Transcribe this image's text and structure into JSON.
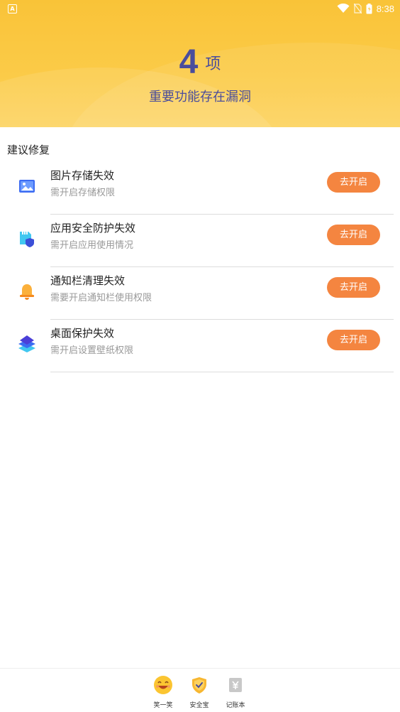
{
  "status_bar": {
    "left_icon": "A",
    "time": "8:38"
  },
  "header": {
    "count": "4",
    "count_unit": "项",
    "subtitle": "重要功能存在漏洞"
  },
  "section": {
    "title": "建议修复"
  },
  "items": [
    {
      "title": "图片存储失效",
      "desc": "需开启存储权限",
      "button": "去开启",
      "icon": "image-icon"
    },
    {
      "title": "应用安全防护失效",
      "desc": "需开启应用使用情况",
      "button": "去开启",
      "icon": "app-shield-icon"
    },
    {
      "title": "通知栏清理失效",
      "desc": "需要开启通知栏使用权限",
      "button": "去开启",
      "icon": "bell-icon"
    },
    {
      "title": "桌面保护失效",
      "desc": "需开启设置壁纸权限",
      "button": "去开启",
      "icon": "layers-icon"
    }
  ],
  "bottom_nav": [
    {
      "label": "笑一笑",
      "icon": "smile-icon"
    },
    {
      "label": "安全宝",
      "icon": "shield-check-icon"
    },
    {
      "label": "记账本",
      "icon": "yen-icon"
    }
  ],
  "colors": {
    "header_yellow": "#f9c338",
    "title_purple": "#4a4d9c",
    "button_orange": "#f48540"
  }
}
